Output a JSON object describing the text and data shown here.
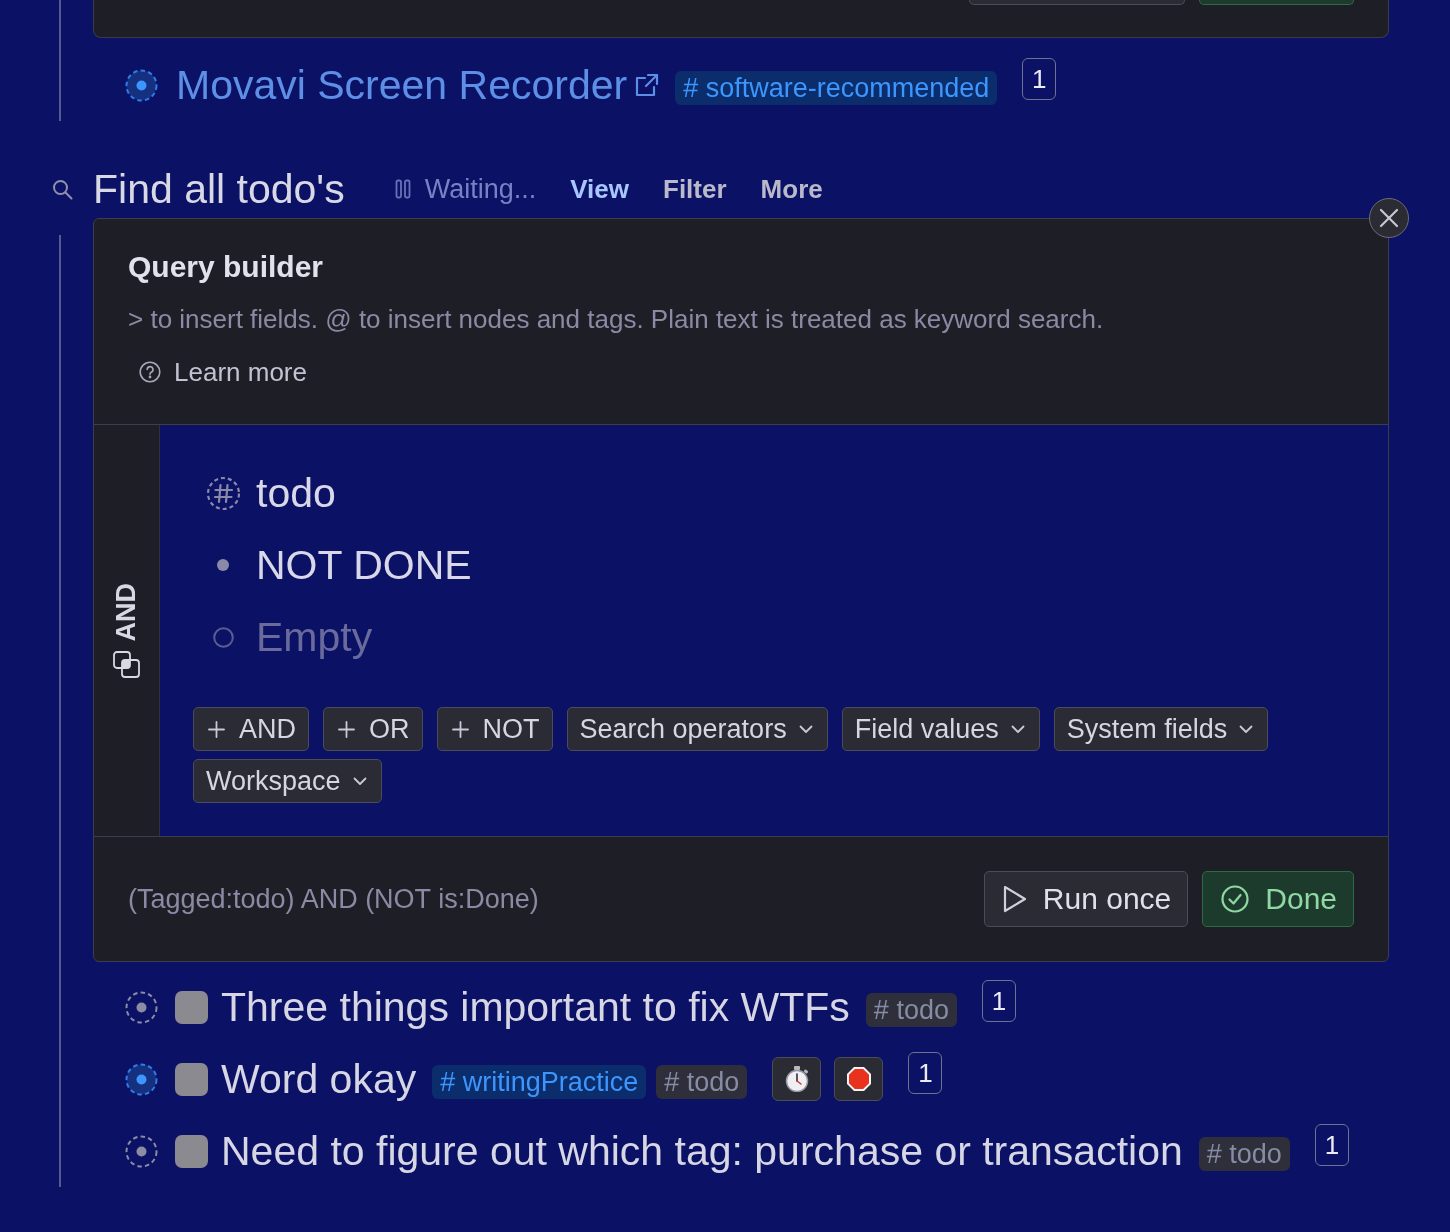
{
  "previous_card": {
    "buttons": [
      {
        "kind": "neutral"
      },
      {
        "kind": "confirm"
      }
    ]
  },
  "nodes_above": [
    {
      "kind": "link",
      "text": "Movavi Screen Recorder",
      "highlighted": true,
      "tags": [
        {
          "text": "# software-recommended",
          "color": "#0b2d6c"
        }
      ],
      "count": "1"
    }
  ],
  "search_node": {
    "title": "Find all todo's",
    "status": "Waiting...",
    "actions": [
      {
        "label": "View",
        "selected": true
      },
      {
        "label": "Filter",
        "selected": false
      },
      {
        "label": "More",
        "selected": false
      }
    ]
  },
  "query_builder": {
    "title": "Query builder",
    "hint": "> to insert fields. @ to insert nodes and tags. Plain text is treated as keyword search.",
    "learn_more": "Learn more",
    "operator": "AND",
    "conditions": [
      {
        "kind": "tag",
        "text": "todo"
      },
      {
        "kind": "keyword",
        "text": "NOT DONE"
      },
      {
        "kind": "input",
        "placeholder": "Empty"
      }
    ],
    "buttons": [
      {
        "kind": "add",
        "label": "AND"
      },
      {
        "kind": "add",
        "label": "OR"
      },
      {
        "kind": "add",
        "label": "NOT"
      },
      {
        "kind": "menu",
        "label": "Search operators"
      },
      {
        "kind": "menu",
        "label": "Field values"
      },
      {
        "kind": "menu",
        "label": "System fields"
      },
      {
        "kind": "menu",
        "label": "Workspace"
      }
    ],
    "expression": "(Tagged:todo) AND (NOT is:Done)",
    "footer_buttons": [
      {
        "kind": "run",
        "label": "Run once"
      },
      {
        "kind": "done",
        "label": "Done"
      }
    ]
  },
  "results": [
    {
      "kind": "todo",
      "text": "Three things important to fix WTFs",
      "highlighted": false,
      "checked": false,
      "tags": [
        {
          "text": "# todo",
          "color": "#2e2f3a"
        }
      ],
      "count": "1"
    },
    {
      "kind": "todo",
      "text": "Word okay",
      "highlighted": true,
      "checked": false,
      "tags": [
        {
          "text": "# writingPractice",
          "color": "#0b2d6c"
        },
        {
          "text": "# todo",
          "color": "#2e2f3a"
        }
      ],
      "emoji_buttons": [
        {
          "kind": "stopwatch"
        },
        {
          "kind": "stop_sign"
        }
      ],
      "count": "1"
    },
    {
      "kind": "todo",
      "text": "Need to figure out which tag: purchase or transaction",
      "highlighted": false,
      "checked": false,
      "tags": [
        {
          "text": "# todo",
          "color": "#2e2f3a"
        }
      ],
      "count": "1"
    }
  ]
}
